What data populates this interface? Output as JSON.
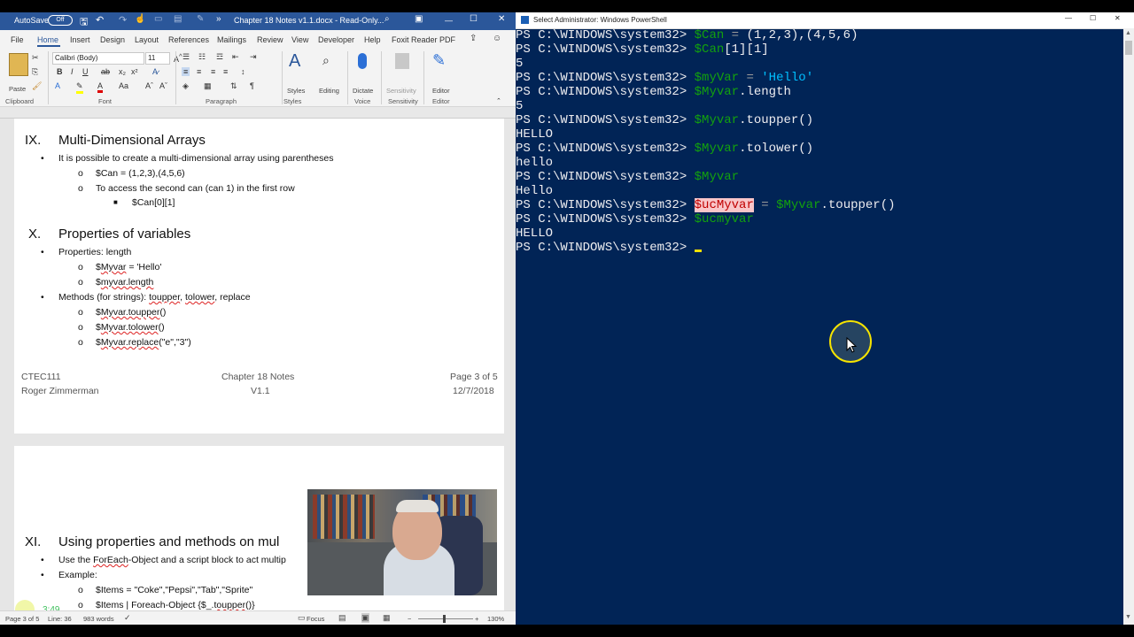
{
  "word": {
    "titlebar": {
      "autosave": "AutoSave",
      "toggle": "Off",
      "more": "»",
      "doc_title": "Chapter 18 Notes v1.1.docx - Read-Only..."
    },
    "tabs": [
      "File",
      "Home",
      "Insert",
      "Design",
      "Layout",
      "References",
      "Mailings",
      "Review",
      "View",
      "Developer",
      "Help",
      "Foxit Reader PDF"
    ],
    "ribbon": {
      "font_name": "Calibri (Body)",
      "font_size": "11",
      "paste": "Paste",
      "groups": {
        "clipboard": "Clipboard",
        "font": "Font",
        "paragraph": "Paragraph",
        "styles": "Styles",
        "voice": "Voice",
        "sensitivity": "Sensitivity",
        "editor": "Editor"
      },
      "buttons": {
        "styles": "Styles",
        "editing": "Editing",
        "dictate": "Dictate",
        "sensitivity": "Sensitivity",
        "editor": "Editor"
      }
    },
    "doc": {
      "sec9": {
        "num": "IX.",
        "title": "Multi-Dimensional Arrays",
        "b1": "It is possible to create a multi-dimensional array using parentheses",
        "s1": "$Can = (1,2,3),(4,5,6)",
        "s2": "To access the second can (can 1) in the first row",
        "s3": "$Can[0][1]"
      },
      "sec10": {
        "num": "X.",
        "title": "Properties of variables",
        "b1": "Properties: length",
        "p1a": "$",
        "p1b": "Myvar",
        "p1c": " = 'Hello'",
        "p2a": "$",
        "p2b": "myvar.length",
        "b2a": "Methods (for strings): ",
        "b2b": "toupper",
        "b2c": ", ",
        "b2d": "tolower",
        "b2e": ", replace",
        "m1a": "$",
        "m1b": "Myvar.toupper",
        "m1c": "()",
        "m2a": "$",
        "m2b": "Myvar.tolower",
        "m2c": "()",
        "m3a": "$",
        "m3b": "Myvar.replace",
        "m3c": "(\"e\",\"3\")"
      },
      "footer": {
        "left1": "CTEC111",
        "left2": "Roger Zimmerman",
        "mid1": "Chapter 18 Notes",
        "mid2": "V1.1",
        "right1": "Page 3 of 5",
        "right2": "12/7/2018"
      },
      "sec11": {
        "num": "XI.",
        "title": "Using properties and methods on mul",
        "b1a": "Use the ",
        "b1b": "ForEach",
        "b1c": "-Object and a script block to act multip",
        "b2": "Example:",
        "e1": "$Items = \"Coke\",\"Pepsi\",\"Tab\",\"Sprite\"",
        "e2a": "$Items | Foreach-Object {$_.",
        "e2b": "toupper",
        "e2c": "()}"
      }
    },
    "timestamp": "3:49",
    "status": {
      "page": "Page 3 of 5",
      "line": "Line: 36",
      "words": "983 words",
      "focus": "Focus",
      "zoom": "130%"
    }
  },
  "powershell": {
    "title": "Select Administrator: Windows PowerShell",
    "prompt": "PS C:\\WINDOWS\\system32> ",
    "l1": {
      "v": "$Can",
      "op": " = ",
      "code": "(1,2,3),(4,5,6)"
    },
    "l2": {
      "v": "$Can",
      "rest": "[1][1]"
    },
    "o2": "5",
    "l3": {
      "v": "$myVar",
      "op": " = ",
      "str": "'Hello'"
    },
    "l4": {
      "v": "$Myvar",
      "rest": ".length"
    },
    "o4": "5",
    "l5": {
      "v": "$Myvar",
      "rest": ".toupper()"
    },
    "o5": "HELLO",
    "l6": {
      "v": "$Myvar",
      "rest": ".tolower()"
    },
    "o6": "hello",
    "l7": {
      "v": "$Myvar"
    },
    "o7": "Hello",
    "l8": {
      "v": "$ucMyvar",
      "op": " = ",
      "v2": "$Myvar",
      "rest": ".toupper()"
    },
    "l9": {
      "v": "$ucmyvar"
    },
    "o9": "HELLO"
  }
}
